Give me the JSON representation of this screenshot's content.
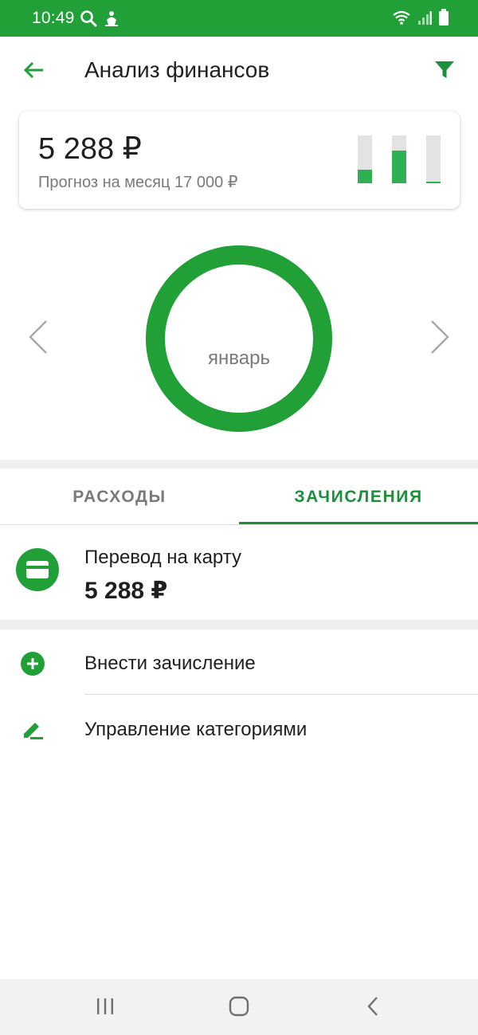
{
  "status_bar": {
    "time": "10:49",
    "icons": [
      "search-icon",
      "notification-icon",
      "wifi-icon",
      "signal-icon",
      "battery-icon"
    ]
  },
  "header": {
    "title": "Анализ финансов",
    "back_icon": "back-arrow-icon",
    "filter_icon": "filter-icon"
  },
  "summary": {
    "amount": "5 288 ₽",
    "forecast": "Прогноз на месяц 17 000 ₽",
    "mini_bars": [
      {
        "fill": 0.28
      },
      {
        "fill": 0.68
      },
      {
        "fill": 0.04
      }
    ]
  },
  "period": {
    "month": "январь",
    "ring_fill": 1.0
  },
  "tabs": [
    {
      "label": "РАСХОДЫ",
      "active": false
    },
    {
      "label": "ЗАЧИСЛЕНИЯ",
      "active": true
    }
  ],
  "transaction": {
    "icon": "card-icon",
    "title": "Перевод на карту",
    "amount": "5 288 ₽"
  },
  "actions": [
    {
      "icon": "add-circle-icon",
      "label": "Внести зачисление"
    },
    {
      "icon": "edit-icon",
      "label": "Управление категориями"
    }
  ],
  "colors": {
    "accent": "#21a038",
    "accent_dark": "#1b8f3a",
    "bar_fill": "#2fb053",
    "bar_track": "#e3e3e3",
    "muted_text": "#7a7a7a"
  }
}
